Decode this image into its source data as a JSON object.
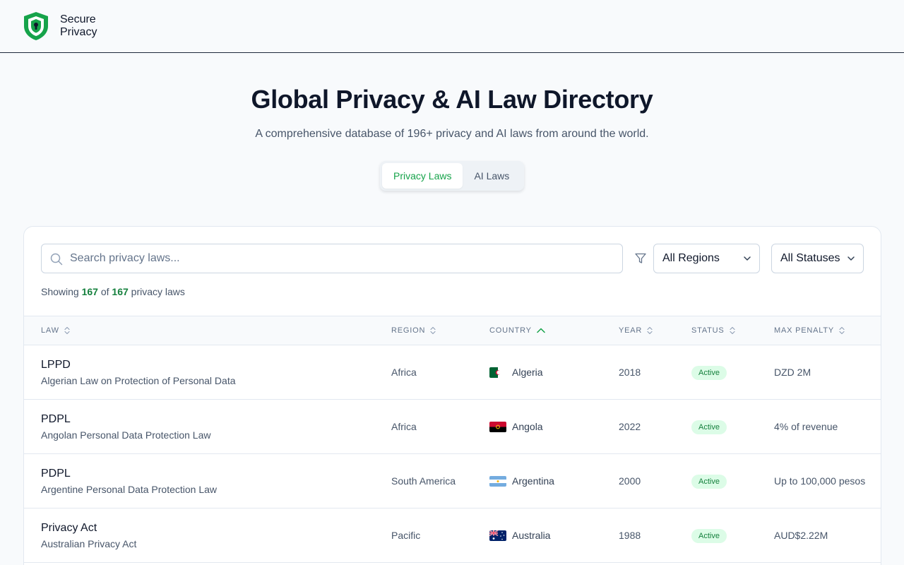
{
  "brand": {
    "line1": "Secure",
    "line2": "Privacy",
    "accent": "#16a34a"
  },
  "hero": {
    "title": "Global Privacy & AI Law Directory",
    "subtitle": "A comprehensive database of 196+ privacy and AI laws from around the world."
  },
  "tabs": [
    {
      "label": "Privacy Laws",
      "active": true
    },
    {
      "label": "AI Laws",
      "active": false
    }
  ],
  "search": {
    "placeholder": "Search privacy laws...",
    "value": ""
  },
  "filters": {
    "region": "All Regions",
    "status": "All Statuses"
  },
  "summary": {
    "prefix": "Showing",
    "shown": "167",
    "of": "of",
    "total": "167",
    "suffix": "privacy laws"
  },
  "columns": [
    {
      "label": "LAW",
      "sort": "none"
    },
    {
      "label": "REGION",
      "sort": "none"
    },
    {
      "label": "COUNTRY",
      "sort": "asc"
    },
    {
      "label": "YEAR",
      "sort": "none"
    },
    {
      "label": "STATUS",
      "sort": "none"
    },
    {
      "label": "MAX PENALTY",
      "sort": "none"
    }
  ],
  "rows": [
    {
      "short": "LPPD",
      "full": "Algerian Law on Protection of Personal Data",
      "region": "Africa",
      "country": "Algeria",
      "flag": "algeria-flag",
      "year": "2018",
      "status": "Active",
      "penalty": "DZD 2M"
    },
    {
      "short": "PDPL",
      "full": "Angolan Personal Data Protection Law",
      "region": "Africa",
      "country": "Angola",
      "flag": "angola-flag",
      "year": "2022",
      "status": "Active",
      "penalty": "4% of revenue"
    },
    {
      "short": "PDPL",
      "full": "Argentine Personal Data Protection Law",
      "region": "South America",
      "country": "Argentina",
      "flag": "argentina-flag",
      "year": "2000",
      "status": "Active",
      "penalty": "Up to 100,000 pesos"
    },
    {
      "short": "Privacy Act",
      "full": "Australian Privacy Act",
      "region": "Pacific",
      "country": "Australia",
      "flag": "australia-flag",
      "year": "1988",
      "status": "Active",
      "penalty": "AUD$2.22M"
    }
  ]
}
